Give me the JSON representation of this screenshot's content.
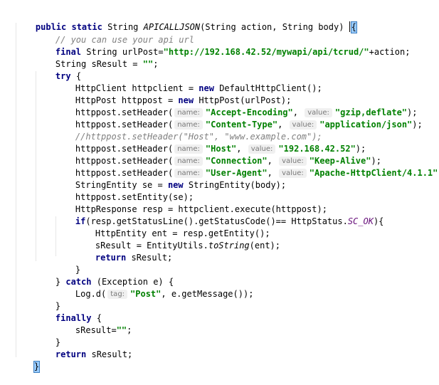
{
  "lines": {
    "l01": {
      "pre": "public static ",
      "ret": "String ",
      "name": "APICALLJSON",
      "params": "(String action, String body) ",
      "brace": "{"
    },
    "l02": {
      "comment": "// you can use your api url"
    },
    "l03": {
      "kw": "final ",
      "a": "String urlPost=",
      "str": "\"http://192.168.42.52/mywapi/api/tcrud/\"",
      "b": "+action;"
    },
    "l04": {
      "a": "String sResult = ",
      "str": "\"\"",
      "b": ";"
    },
    "l05": {
      "kw": "try ",
      "a": "{"
    },
    "l06": {
      "a": "HttpClient httpclient = ",
      "kw": "new ",
      "b": "DefaultHttpClient();"
    },
    "l07": {
      "a": "HttpPost httppost = ",
      "kw": "new ",
      "b": "HttpPost(urlPost);"
    },
    "l08": {
      "a": "httppost.setHeader(",
      "h1": "name:",
      "s1": "\"Accept-Encoding\"",
      "c": ", ",
      "h2": "value:",
      "s2": "\"gzip,deflate\"",
      "e": ");"
    },
    "l09": {
      "a": "httppost.setHeader(",
      "h1": "name:",
      "s1": "\"Content-Type\"",
      "c": ", ",
      "h2": "value:",
      "s2": "\"application/json\"",
      "e": ");"
    },
    "l10": {
      "comment": "//httppost.setHeader(\"Host\", \"www.example.com\");"
    },
    "l11": {
      "a": "httppost.setHeader(",
      "h1": "name:",
      "s1": "\"Host\"",
      "c": ", ",
      "h2": "value:",
      "s2": "\"192.168.42.52\"",
      "e": ");"
    },
    "l12": {
      "a": "httppost.setHeader(",
      "h1": "name:",
      "s1": "\"Connection\"",
      "c": ", ",
      "h2": "value:",
      "s2": "\"Keep-Alive\"",
      "e": ");"
    },
    "l13": {
      "a": "httppost.setHeader(",
      "h1": "name:",
      "s1": "\"User-Agent\"",
      "c": ", ",
      "h2": "value:",
      "s2": "\"Apache-HttpClient/4.1.1\"",
      "e": ");"
    },
    "l14": {
      "a": "StringEntity se = ",
      "kw": "new ",
      "b": "StringEntity(body);"
    },
    "l15": {
      "a": "httppost.setEntity(se);"
    },
    "l16": {
      "a": "HttpResponse resp = httpclient.execute(httppost);"
    },
    "l17": {
      "kw": "if",
      "a": "(resp.getStatusLine().getStatusCode()== HttpStatus.",
      "sf": "SC_OK",
      "b": "){"
    },
    "l18": {
      "a": "HttpEntity ent = resp.getEntity();"
    },
    "l19": {
      "a": "sResult = EntityUtils.",
      "mi": "toString",
      "b": "(ent);"
    },
    "l20": {
      "kw": "return ",
      "a": "sResult;"
    },
    "l21": {
      "a": "}"
    },
    "l22": {
      "a": "} ",
      "kw": "catch ",
      "b": "(Exception e) {"
    },
    "l23": {
      "a": "Log.d(",
      "h1": "tag:",
      "s1": "\"Post\"",
      "b": ", e.getMessage());"
    },
    "l24": {
      "a": "}"
    },
    "l25": {
      "kw": "finally ",
      "a": "{"
    },
    "l26": {
      "a": "sResult=",
      "str": "\"\"",
      "b": ";"
    },
    "l27": {
      "a": "}"
    },
    "l28": {
      "kw": "return ",
      "a": "sResult;"
    },
    "l29": {
      "brace": "}"
    }
  }
}
